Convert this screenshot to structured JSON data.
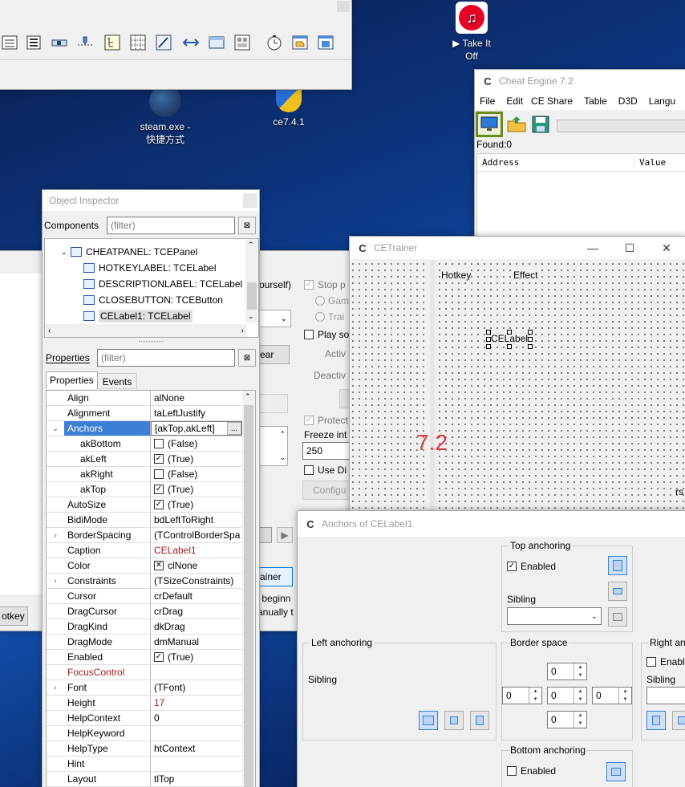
{
  "desktop": {
    "icons": [
      {
        "label": "▶ Take It\nOff"
      },
      {
        "label": "steam.exe -\n快捷方式"
      },
      {
        "label": "ce7.4.1"
      }
    ],
    "overlay_text": "7.2"
  },
  "colors": {
    "accent": "#3c7fd6",
    "red_value": "#9a1b1b",
    "overlay_red": "#e03c3c",
    "ce_green": "#6aa52b"
  },
  "cheat_engine": {
    "title": "Cheat Engine 7.2",
    "menu": [
      "File",
      "Edit",
      "CE Share",
      "Table",
      "D3D",
      "Langu"
    ],
    "found": "Found:0",
    "columns": [
      "Address",
      "Value"
    ]
  },
  "object_inspector": {
    "title": "Object Inspector",
    "components_label": "Components",
    "filter_placeholder": "(filter)",
    "tree": [
      {
        "label": "CHEATPANEL: TCEPanel",
        "level": 1,
        "expanded": true
      },
      {
        "label": "HOTKEYLABEL: TCELabel",
        "level": 2
      },
      {
        "label": "DESCRIPTIONLABEL: TCELabel",
        "level": 2
      },
      {
        "label": "CLOSEBUTTON: TCEButton",
        "level": 2
      },
      {
        "label": "CELabel1: TCELabel",
        "level": 2,
        "selected": true
      }
    ],
    "properties_label": "Properties",
    "tabs": [
      "Properties",
      "Events"
    ],
    "props": [
      {
        "k": "Align",
        "v": "alNone"
      },
      {
        "k": "Alignment",
        "v": "taLeftJustify"
      },
      {
        "k": "Anchors",
        "v": "[akTop,akLeft]",
        "selected": true,
        "expanded": true
      },
      {
        "k": "akBottom",
        "v": "(False)",
        "indent": true,
        "check": false
      },
      {
        "k": "akLeft",
        "v": "(True)",
        "indent": true,
        "check": true
      },
      {
        "k": "akRight",
        "v": "(False)",
        "indent": true,
        "check": false
      },
      {
        "k": "akTop",
        "v": "(True)",
        "indent": true,
        "check": true
      },
      {
        "k": "AutoSize",
        "v": "(True)",
        "check": true
      },
      {
        "k": "BidiMode",
        "v": "bdLeftToRight"
      },
      {
        "k": "BorderSpacing",
        "v": "(TControlBorderSpa",
        "expandable": true
      },
      {
        "k": "Caption",
        "v": "CELabel1",
        "red": true
      },
      {
        "k": "Color",
        "v": "clNone",
        "color_box": true
      },
      {
        "k": "Constraints",
        "v": "(TSizeConstraints)",
        "expandable": true
      },
      {
        "k": "Cursor",
        "v": "crDefault"
      },
      {
        "k": "DragCursor",
        "v": "crDrag"
      },
      {
        "k": "DragKind",
        "v": "dkDrag"
      },
      {
        "k": "DragMode",
        "v": "dmManual"
      },
      {
        "k": "Enabled",
        "v": "(True)",
        "check": true
      },
      {
        "k": "FocusControl",
        "v": "",
        "red_key": true
      },
      {
        "k": "Font",
        "v": "(TFont)",
        "expandable": true
      },
      {
        "k": "Height",
        "v": "17",
        "red": true
      },
      {
        "k": "HelpContext",
        "v": "0"
      },
      {
        "k": "HelpKeyword",
        "v": ""
      },
      {
        "k": "HelpType",
        "v": "htContext"
      },
      {
        "k": "Hint",
        "v": ""
      },
      {
        "k": "Layout",
        "v": "tlTop"
      }
    ]
  },
  "trainer_form": {
    "partial_labels": {
      "yourself": "ourself)",
      "stop": "Stop p",
      "gam": "Gam",
      "trai": "Trai",
      "play": "Play so",
      "activ": "Activ",
      "deactiv": "Deactiv",
      "protect": "Protect",
      "freeze": "Freeze int",
      "freeze_value": "250",
      "use": "Use Di",
      "configu": "Configu",
      "ear": "ear",
      "trainer": "rainer",
      "begin": "r beginn",
      "manually": "anually t",
      "hotkey": "otkey",
      "rs": "rs"
    }
  },
  "ce_trainer": {
    "title": "CETrainer",
    "hotkey_header": "Hotkey",
    "effect_header": "Effect",
    "label": "CELabel"
  },
  "anchors_dialog": {
    "title": "Anchors of CELabel1",
    "top_anchoring": "Top anchoring",
    "enabled": "Enabled",
    "sibling": "Sibling",
    "left_anchoring": "Left anchoring",
    "border_space": "Border space",
    "right_anchoring": "Right and",
    "right_enabled": "Enable",
    "bottom_anchoring": "Bottom anchoring",
    "spin_values": [
      "0",
      "0",
      "0",
      "0",
      "0"
    ]
  }
}
